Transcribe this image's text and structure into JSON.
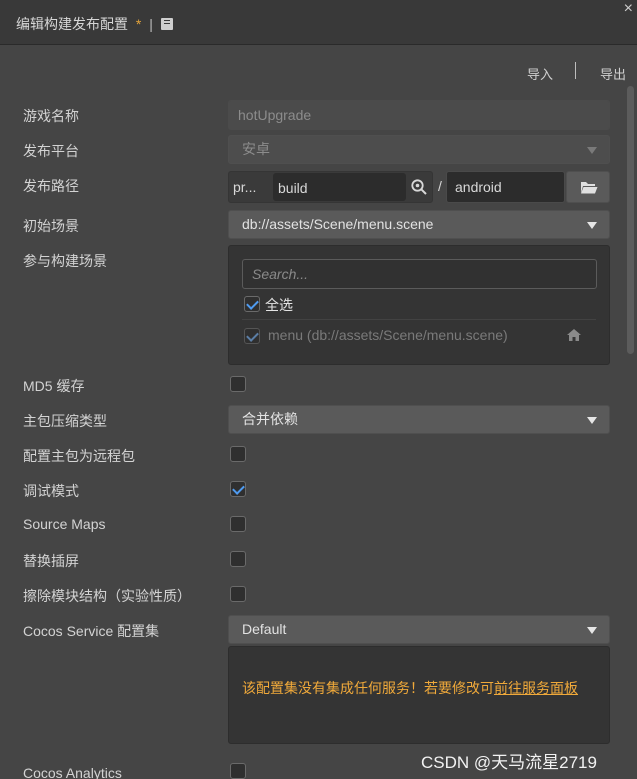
{
  "window": {
    "title": "编辑构建发布配置",
    "modified_mark": "*",
    "separator": "|",
    "close_label": "×"
  },
  "toolbar": {
    "import_label": "导入",
    "separator": "|",
    "export_label": "导出"
  },
  "fields": {
    "game_name": {
      "label": "游戏名称",
      "value": "hotUpgrade"
    },
    "platform": {
      "label": "发布平台",
      "value": "安卓"
    },
    "build_path": {
      "label": "发布路径",
      "prefix": "pr...",
      "folder": "build",
      "slash": "/",
      "subfolder": "android"
    },
    "start_scene": {
      "label": "初始场景",
      "value": "db://assets/Scene/menu.scene"
    },
    "included_scenes": {
      "label": "参与构建场景",
      "search_placeholder": "Search...",
      "select_all_label": "全选",
      "select_all_checked": true,
      "scenes": [
        {
          "name": "menu",
          "path": "(db://assets/Scene/menu.scene)",
          "checked": true
        }
      ]
    },
    "md5_cache": {
      "label": "MD5 缓存",
      "checked": false
    },
    "main_bundle_compression": {
      "label": "主包压缩类型",
      "value": "合并依赖"
    },
    "main_bundle_remote": {
      "label": "配置主包为远程包",
      "checked": false
    },
    "debug_mode": {
      "label": "调试模式",
      "checked": true
    },
    "source_maps": {
      "label": "Source Maps",
      "checked": false
    },
    "replace_splash": {
      "label": "替换插屏",
      "checked": false
    },
    "erase_module_structure": {
      "label": "擦除模块结构（实验性质）",
      "checked": false
    },
    "cocos_service": {
      "label": "Cocos Service 配置集",
      "value": "Default",
      "notice_text": "该配置集没有集成任何服务！若要修改可",
      "notice_link": "前往服务面板"
    },
    "cocos_analytics": {
      "label": "Cocos Analytics",
      "checked": false
    }
  },
  "watermark": "CSDN @天马流星2719",
  "colors": {
    "accent_blue": "#4f9bf0",
    "modified_star": "#e2a33b",
    "notice_orange": "#f0a93a"
  }
}
